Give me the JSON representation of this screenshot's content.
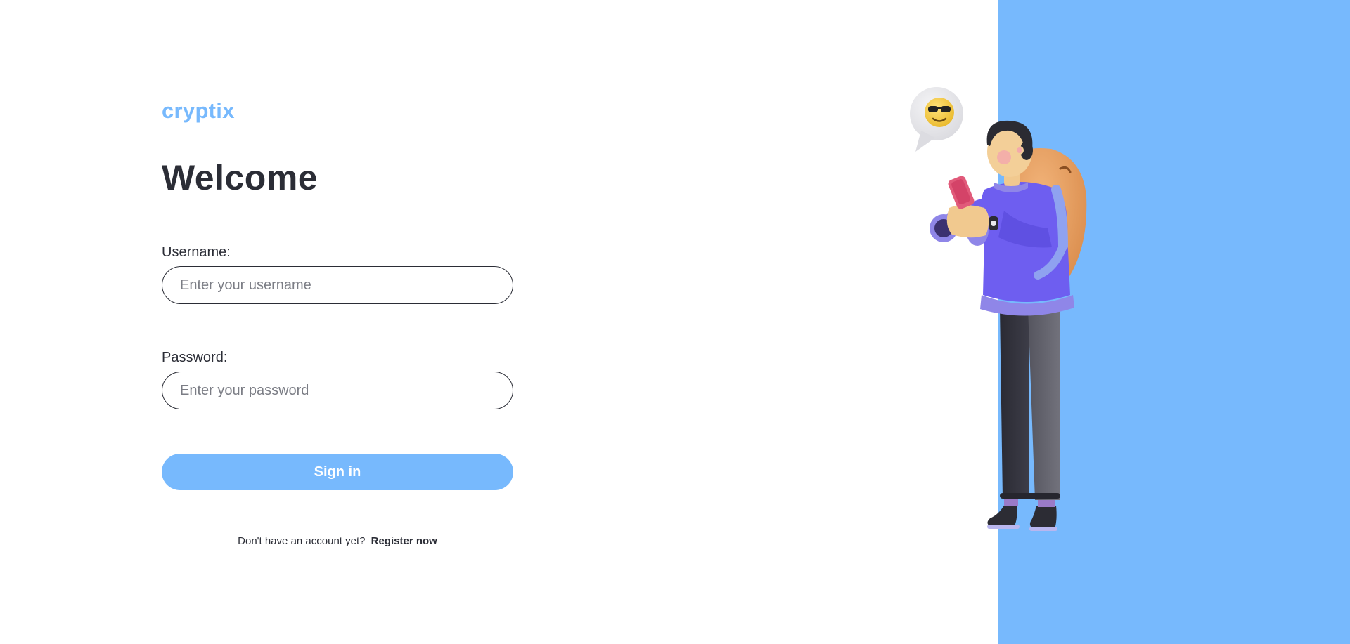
{
  "brand": {
    "name": "cryptix",
    "accent_color": "#77b9fd"
  },
  "login": {
    "title": "Welcome",
    "username": {
      "label": "Username:",
      "placeholder": "Enter your username",
      "value": ""
    },
    "password": {
      "label": "Password:",
      "placeholder": "Enter your password",
      "value": ""
    },
    "submit_label": "Sign in",
    "register_prompt": "Don't have an account yet?",
    "register_link": "Register now"
  },
  "illustration": {
    "subject": "person-with-backpack-using-phone",
    "bubble_icon": "sunglasses-emoji-icon"
  }
}
